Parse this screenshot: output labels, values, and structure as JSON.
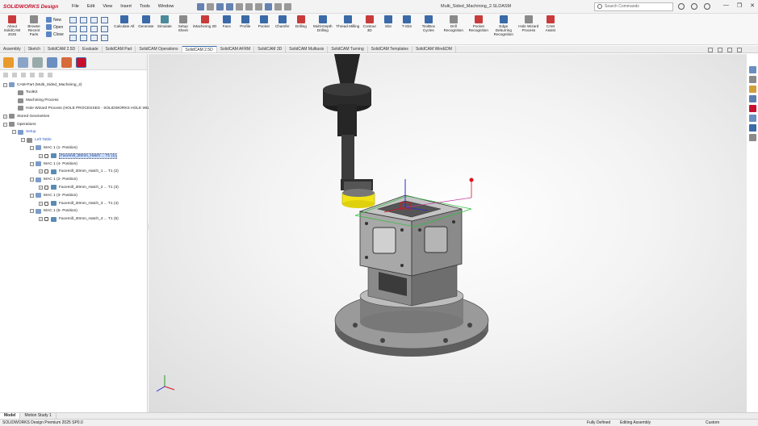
{
  "titlebar": {
    "logo": "SOLIDWORKS Design",
    "menus": [
      "File",
      "Edit",
      "View",
      "Insert",
      "Tools",
      "Window"
    ],
    "document_title": "Multi_Sided_Machining_2.SLDASM",
    "search_placeholder": "Search Commands",
    "window_controls": [
      "—",
      "❐",
      "✕"
    ]
  },
  "ribbon": {
    "about": "About SolidCAM 2025",
    "browse": "Browse Recent Parts",
    "file_new": "New",
    "file_open": "Open",
    "file_close": "Close",
    "buttons": [
      {
        "label": "Calculate All",
        "color": "blue"
      },
      {
        "label": "Generate",
        "color": "blue"
      },
      {
        "label": "Simulate",
        "color": "teal"
      },
      {
        "label": "Setup Sheet",
        "color": "gray"
      },
      {
        "label": "iMachining 2D",
        "color": "red"
      },
      {
        "label": "Face",
        "color": "blue"
      },
      {
        "label": "Profile",
        "color": "blue"
      },
      {
        "label": "Pocket",
        "color": "blue"
      },
      {
        "label": "Chamfer",
        "color": "blue"
      },
      {
        "label": "Drilling",
        "color": "red"
      },
      {
        "label": "Multi-Depth Drilling",
        "color": "blue"
      },
      {
        "label": "Thread Milling",
        "color": "blue"
      },
      {
        "label": "Contour 3D",
        "color": "red"
      },
      {
        "label": "Slot",
        "color": "blue"
      },
      {
        "label": "T-Slot",
        "color": "blue"
      },
      {
        "label": "ToolBox Cycles",
        "color": "blue"
      },
      {
        "label": "Drill Recognition",
        "color": "gray"
      },
      {
        "label": "Pocket Recognition",
        "color": "red"
      },
      {
        "label": "Edge Deburring Recognition",
        "color": "blue"
      },
      {
        "label": "Hole Wizard Process",
        "color": "gray"
      },
      {
        "label": "CAM Assist",
        "color": "red"
      }
    ]
  },
  "tabs": [
    "Assembly",
    "Sketch",
    "SolidCAM 2.5D",
    "Evaluate",
    "SolidCAM Part",
    "SolidCAM Operations",
    "SolidCAM 2.5D",
    "SolidCAM AFRM",
    "SolidCAM 3D",
    "SolidCAM Multiaxis",
    "SolidCAM Turning",
    "SolidCAM Templates",
    "SolidCAM WireEDM"
  ],
  "active_tab_index": 6,
  "tree": [
    {
      "label": "CAM-Part (Multi_Sided_Machining_2)",
      "depth": 0,
      "icon": "cam",
      "exp": "−"
    },
    {
      "label": "ToolKit",
      "depth": 1,
      "icon": "fold",
      "exp": ""
    },
    {
      "label": "Machining Process",
      "depth": 1,
      "icon": "fold",
      "exp": ""
    },
    {
      "label": "Hole Wizard Process (HOLE PROCESSES - SOLIDWORKS HOLE WIZ...",
      "depth": 1,
      "icon": "fold",
      "exp": ""
    },
    {
      "label": "Stored Geometries",
      "depth": 0,
      "icon": "fold",
      "exp": "+"
    },
    {
      "label": "Operations",
      "depth": 0,
      "icon": "fold",
      "exp": "−"
    },
    {
      "label": "Setup",
      "depth": 1,
      "icon": "cam",
      "exp": "−",
      "link": true
    },
    {
      "label": "Left Table",
      "depth": 2,
      "icon": "fold",
      "exp": "−",
      "link": true
    },
    {
      "label": "MAC 1 (1- Position)",
      "depth": 3,
      "icon": "cam",
      "exp": "−"
    },
    {
      "label": "Facemill_30mm_Hatch ... T1 (1)",
      "depth": 4,
      "icon": "op",
      "exp": "+",
      "sel": true
    },
    {
      "label": "MAC 1 (4- Position)",
      "depth": 3,
      "icon": "cam",
      "exp": "−"
    },
    {
      "label": "Facemill_30mm_Hatch_1 ... T1 (2)",
      "depth": 4,
      "icon": "op",
      "exp": "+"
    },
    {
      "label": "MAC 1 (2- Position)",
      "depth": 3,
      "icon": "cam",
      "exp": "−"
    },
    {
      "label": "Facemill_30mm_Hatch_2 ... T1 (3)",
      "depth": 4,
      "icon": "op",
      "exp": "+"
    },
    {
      "label": "MAC 1 (3- Position)",
      "depth": 3,
      "icon": "cam",
      "exp": "−"
    },
    {
      "label": "Facemill_30mm_Hatch_3 ... T1 (4)",
      "depth": 4,
      "icon": "op",
      "exp": "+"
    },
    {
      "label": "MAC 1 (5- Position)",
      "depth": 3,
      "icon": "cam",
      "exp": "−"
    },
    {
      "label": "Facemill_30mm_Hatch_4 ... T1 (5)",
      "depth": 4,
      "icon": "op",
      "exp": "+"
    }
  ],
  "bottom_tabs": [
    "Model",
    "Motion Study 1"
  ],
  "status": {
    "product": "SOLIDWORKS Design Premium 2025 SP0.0",
    "defined": "Fully Defined",
    "mode": "Editing Assembly",
    "units": "Custom"
  },
  "colors": {
    "accent": "#3a6aa8",
    "logo": "#c8102e",
    "tool_holder": "#2b2b2b",
    "tool_tip": "#f2e414"
  }
}
